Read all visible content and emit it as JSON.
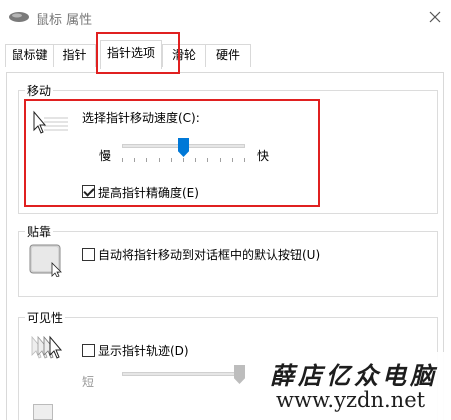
{
  "window": {
    "title": "鼠标 属性",
    "close_label": "✕"
  },
  "tabs": [
    {
      "label": "鼠标键"
    },
    {
      "label": "指针"
    },
    {
      "label": "指针选项",
      "selected": true
    },
    {
      "label": "滑轮"
    },
    {
      "label": "硬件"
    }
  ],
  "motion": {
    "group_label": "移动",
    "speed_label": "选择指针移动速度(C):",
    "slow_label": "慢",
    "fast_label": "快",
    "speed_level": 0.5,
    "precision_label": "提高指针精确度(E)",
    "precision_checked": true
  },
  "snap": {
    "group_label": "贴靠",
    "checkbox_label": "自动将指针移动到对话框中的默认按钮(U)",
    "checked": false
  },
  "visibility": {
    "group_label": "可见性",
    "trails_label": "显示指针轨迹(D)",
    "trails_checked": false,
    "short_label": "短",
    "trail_level": 1.0
  },
  "watermark": {
    "chinese": "薛店亿众电脑",
    "url": "www.yzdn.net"
  },
  "colors": {
    "highlight": "#e02020",
    "slider_thumb": "#0078d7"
  }
}
